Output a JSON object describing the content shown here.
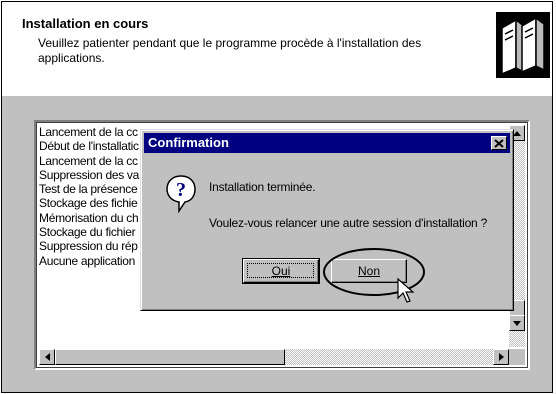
{
  "header": {
    "title": "Installation en cours",
    "subtitle": "Veuillez patienter pendant que le programme procède à l'installation des applications."
  },
  "log": {
    "items": [
      "Lancement de la cc",
      "Début de l'installatic",
      "Lancement de la cc",
      "Suppression des va",
      "Test de la présence",
      "Stockage des fichie",
      "Mémorisation du ch",
      "Stockage du fichier",
      "Suppression du rép",
      "Aucune application"
    ]
  },
  "dialog": {
    "title": "Confirmation",
    "close_glyph": "✕",
    "message_line1": "Installation terminée.",
    "message_line2": "Voulez-vous relancer une autre session d'installation ?",
    "icon": "question-icon",
    "yes_label": "Oui",
    "no_label": "Non"
  },
  "colors": {
    "titlebar": "#000080",
    "face": "#c0c0c0"
  }
}
